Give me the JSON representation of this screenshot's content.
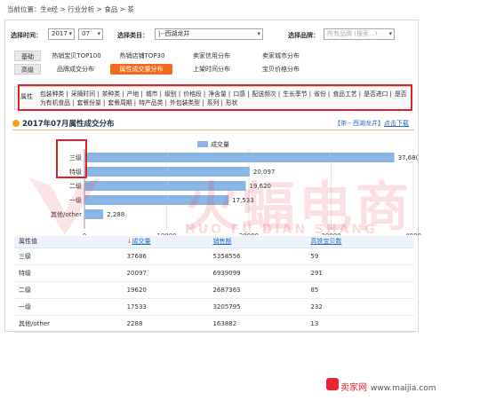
{
  "breadcrumb": "当前位置：生e经 > 行业分析 > 食品 > 茶",
  "selectors": {
    "time_label": "选择时间：",
    "year": "2017",
    "month": "07",
    "category_label": "选择类目：",
    "category": "|--西湖龙井",
    "brand_label": "选择品牌：",
    "brand_placeholder": "所有品牌 (搜索...)"
  },
  "tabs": {
    "basic": "基础",
    "advanced": "高级",
    "row1": [
      "热销宝贝TOP100",
      "热销店铺TOP30",
      "卖家信用分布",
      "卖家城市分布"
    ],
    "row2": [
      "品牌成交分布",
      "属性成交量分布",
      "上架时间分布",
      "宝贝价格分布"
    ]
  },
  "attr": {
    "header": "属性",
    "items": [
      "包装种类",
      "采摘时间",
      "茶种类",
      "产地",
      "城市",
      "级别",
      "价格段",
      "净含量",
      "口感",
      "配送频次",
      "生长季节",
      "省份",
      "食品工艺",
      "是否进口",
      "是否为有机食品",
      "套餐份量",
      "套餐周期",
      "特产品类",
      "外包装类型",
      "系列",
      "形状"
    ]
  },
  "title": "2017年07月属性成交分布",
  "title_tag": "【茶 - 西湖龙井】",
  "export": "点击下载",
  "legend": "成交量",
  "chart_data": {
    "type": "bar",
    "orientation": "horizontal",
    "categories": [
      "三级",
      "特级",
      "二级",
      "一级",
      "其他/other"
    ],
    "series": [
      {
        "name": "成交量",
        "values": [
          37686,
          20097,
          19620,
          17533,
          2288
        ]
      }
    ],
    "xlim": [
      0,
      40000
    ],
    "xticks": [
      "0",
      "10000",
      "20000",
      "30000",
      "4000"
    ],
    "value_labels": [
      "37,68(",
      "20,097",
      "19,620",
      "17,533",
      "2,288"
    ],
    "color": "#8ab6e4"
  },
  "table": {
    "headers": [
      "属性值",
      "成交量",
      "销售额",
      "高铁宝贝数"
    ],
    "rows": [
      [
        "三级",
        "37686",
        "5358556",
        "59"
      ],
      [
        "特级",
        "20097",
        "6939099",
        "291"
      ],
      [
        "二级",
        "19620",
        "2687363",
        "85"
      ],
      [
        "一级",
        "17533",
        "3205795",
        "232"
      ],
      [
        "其他/other",
        "2288",
        "163882",
        "13"
      ]
    ]
  },
  "watermark": {
    "cn": "火蝠电商",
    "en": "HUO FU DIAN SHANG"
  },
  "footer": {
    "brand": "卖家网",
    "url": "www.maijia.com"
  },
  "colors": {
    "accent": "#f26a1b",
    "link": "#2a6ac0",
    "red": "#e0202c",
    "bar": "#8ab6e4"
  }
}
